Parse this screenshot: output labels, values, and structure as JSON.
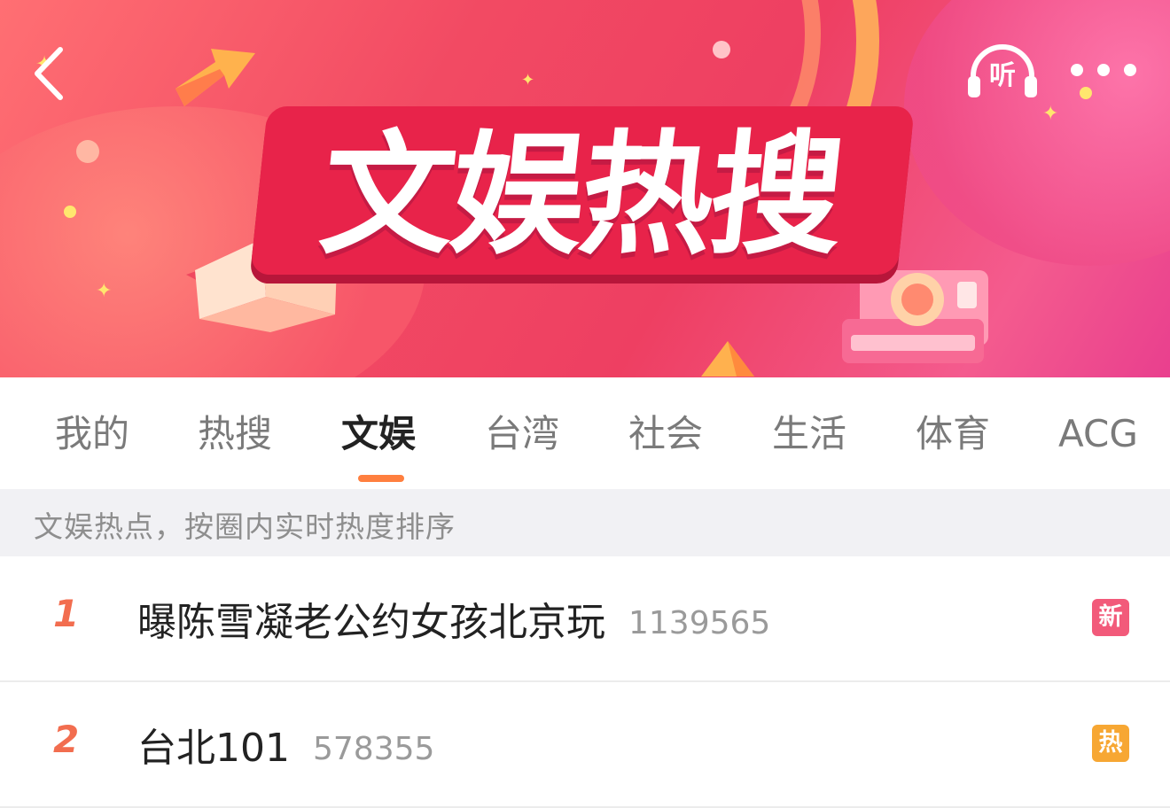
{
  "banner": {
    "title": "文娱热搜",
    "listen_label": "听"
  },
  "tabs": [
    {
      "label": "我的",
      "active": false
    },
    {
      "label": "热搜",
      "active": false
    },
    {
      "label": "文娱",
      "active": true
    },
    {
      "label": "台湾",
      "active": false
    },
    {
      "label": "社会",
      "active": false
    },
    {
      "label": "生活",
      "active": false
    },
    {
      "label": "体育",
      "active": false
    },
    {
      "label": "ACG",
      "active": false
    }
  ],
  "info": {
    "text": "文娱热点，按圈内实时热度排序"
  },
  "list": [
    {
      "rank": "1",
      "title": "曝陈雪凝老公约女孩北京玩",
      "count": "1139565",
      "badge": "新",
      "badge_color": "#f25a7a"
    },
    {
      "rank": "2",
      "title": "台北101",
      "count": "578355",
      "badge": "热",
      "badge_color": "#f7a733"
    }
  ],
  "colors": {
    "accent": "#ff7f3f",
    "rank": "#f26d4f",
    "banner_primary": "#f24a63"
  },
  "icons": {
    "back": "chevron-left-icon",
    "listen": "headphones-icon",
    "more": "more-dots-icon"
  }
}
